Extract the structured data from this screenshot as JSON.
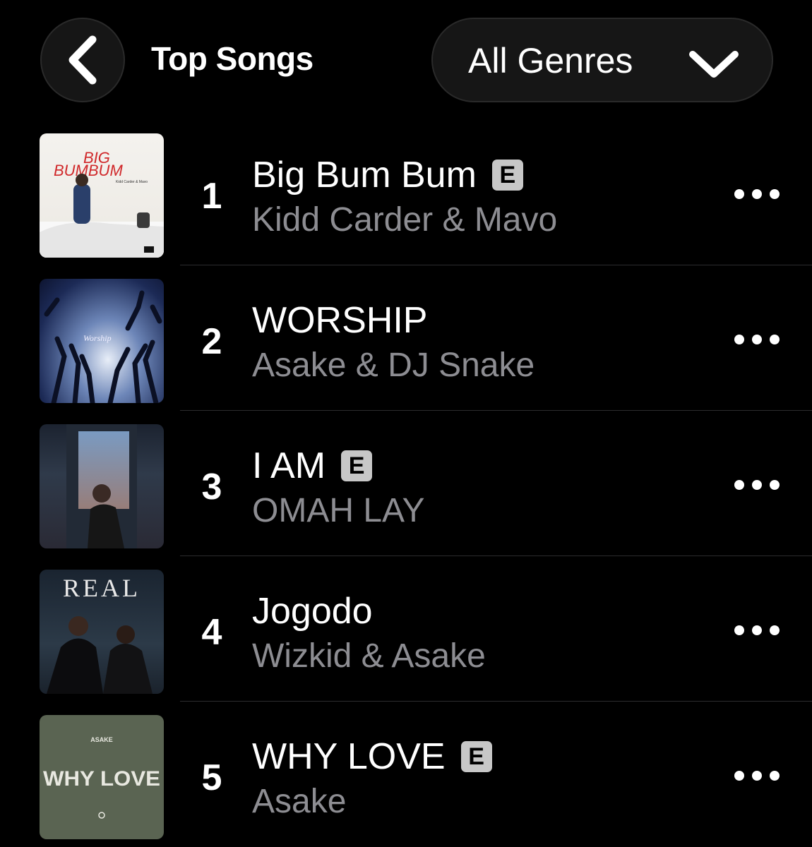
{
  "header": {
    "title": "Top Songs",
    "genre_label": "All Genres"
  },
  "songs": [
    {
      "rank": "1",
      "title": "Big Bum Bum",
      "artist": "Kidd Carder & Mavo",
      "explicit": true,
      "cover_text": {
        "top": "BIG",
        "bottom": "BUMBUM",
        "small": "Kidd Carder & Mavo"
      }
    },
    {
      "rank": "2",
      "title": "WORSHIP",
      "artist": "Asake & DJ Snake",
      "explicit": false,
      "cover_text": {
        "main": "Worship"
      }
    },
    {
      "rank": "3",
      "title": "I AM",
      "artist": "OMAH LAY",
      "explicit": true
    },
    {
      "rank": "4",
      "title": "Jogodo",
      "artist": "Wizkid & Asake",
      "explicit": false,
      "cover_text": {
        "main": "REAL"
      }
    },
    {
      "rank": "5",
      "title": "WHY LOVE",
      "artist": "Asake",
      "explicit": true,
      "cover_text": {
        "top": "ASAKE",
        "main": "WHY LOVE"
      }
    }
  ],
  "explicit_badge": "E",
  "colors": {
    "background": "#000000",
    "secondary_text": "#8d8d92",
    "pill": "#161616"
  }
}
